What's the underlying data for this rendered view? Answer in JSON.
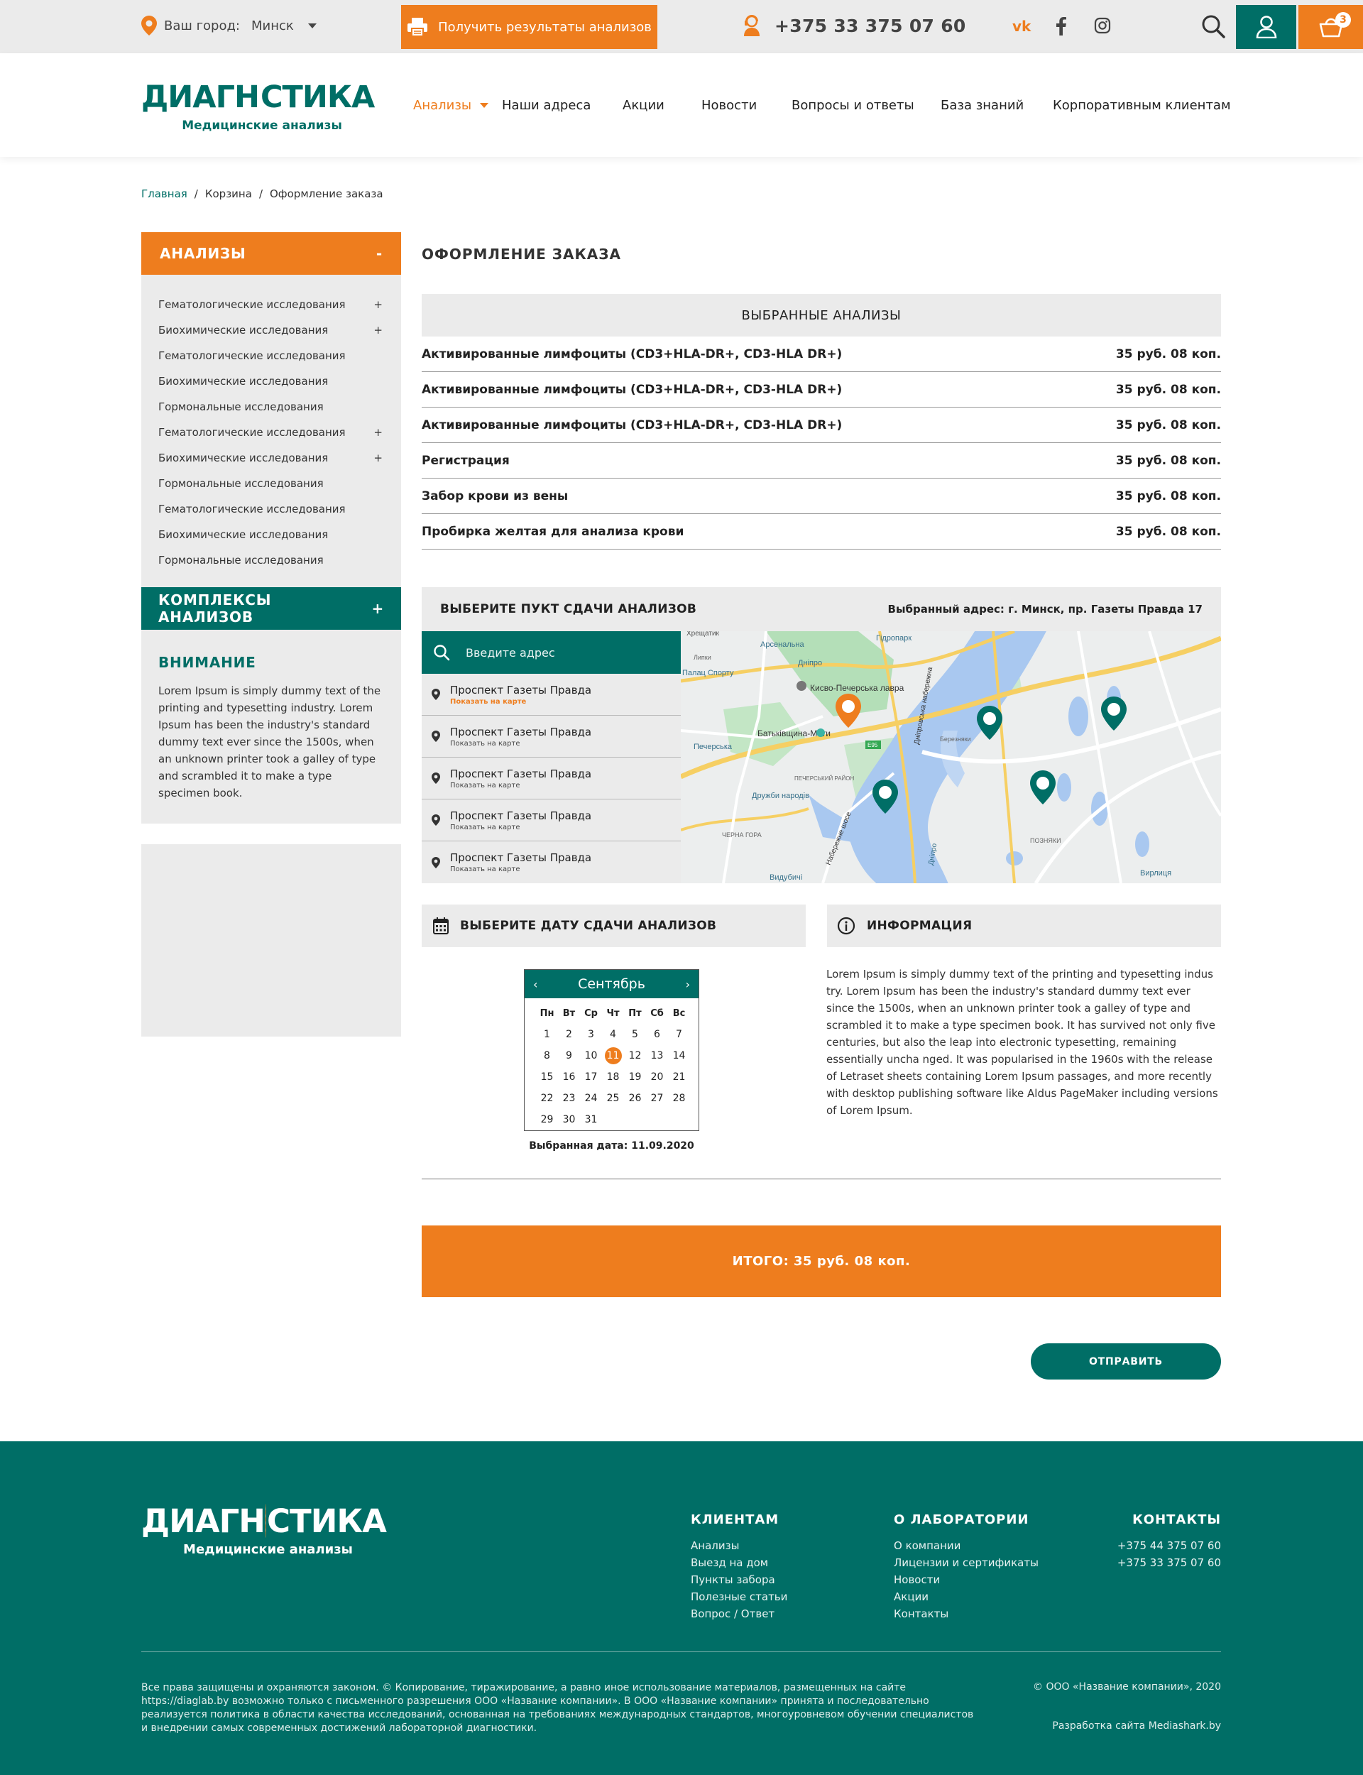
{
  "colors": {
    "accent": "#ee7d1e",
    "brand": "#006e66",
    "panel": "#ebebeb"
  },
  "topbar": {
    "city_label": "Ваш город:",
    "city_value": "Минск",
    "results_button": "Получить результаты анализов",
    "phone": "+375 33 375 07 60",
    "socials": [
      "vk-icon",
      "facebook-icon",
      "instagram-icon"
    ],
    "cart_count": "3"
  },
  "header": {
    "logo_title_left": "ДИАГН",
    "logo_title_right": "СТИКА",
    "logo_subtitle": "Медицинские анализы",
    "nav": [
      "Анализы",
      "Наши адреса",
      "Акции",
      "Новости",
      "Вопросы и ответы",
      "База знаний",
      "Корпоративным клиентам"
    ]
  },
  "breadcrumbs": [
    "Главная",
    "/",
    "Корзина",
    "/",
    "Оформление заказа"
  ],
  "sidebar": {
    "analyses_title": "АНАЛИЗЫ",
    "analyses_toggle": "-",
    "items": [
      {
        "label": "Гематологические исследования",
        "mark": "+"
      },
      {
        "label": "Биохимические исследования",
        "mark": "+"
      },
      {
        "label": "Гематологические исследования",
        "mark": ""
      },
      {
        "label": "Биохимические исследования",
        "mark": ""
      },
      {
        "label": "Гормональные исследования",
        "mark": ""
      },
      {
        "label": "Гематологические исследования",
        "mark": "+"
      },
      {
        "label": "Биохимические исследования",
        "mark": "+"
      },
      {
        "label": "Гормональные исследования",
        "mark": ""
      },
      {
        "label": "Гематологические исследования",
        "mark": ""
      },
      {
        "label": "Биохимические исследования",
        "mark": ""
      },
      {
        "label": "Гормональные исследования",
        "mark": ""
      }
    ],
    "complex_title": "КОМПЛЕКСЫ АНАЛИЗОВ",
    "complex_toggle": "+",
    "attention_title": "ВНИМАНИЕ",
    "attention_text": "Lorem Ipsum is simply dummy text of the printing and typesetting industry. Lorem Ipsum has been the industry's standard dummy text ever since the 1500s, when an unknown printer took a galley of type and scrambled it to make a type specimen book."
  },
  "main": {
    "title": "ОФОРМЛЕНИЕ ЗАКАЗА",
    "selected_title": "ВЫБРАННЫЕ АНАЛИЗЫ",
    "services": [
      {
        "name": "Активированные лимфоциты (CD3+HLA-DR+, CD3-HLA DR+)",
        "price": "35 руб. 08 коп."
      },
      {
        "name": "Активированные лимфоциты (CD3+HLA-DR+, CD3-HLA DR+)",
        "price": "35 руб. 08 коп."
      },
      {
        "name": "Активированные лимфоциты (CD3+HLA-DR+, CD3-HLA DR+)",
        "price": "35 руб. 08 коп."
      },
      {
        "name": "Регистрация",
        "price": "35 руб. 08 коп."
      },
      {
        "name": "Забор крови из вены",
        "price": "35 руб. 08 коп."
      },
      {
        "name": "Пробирка желтая для анализа крови",
        "price": "35 руб. 08 коп."
      }
    ],
    "pickup_title": "ВЫБЕРИТЕ ПУКТ СДАЧИ АНАЛИЗОВ",
    "pickup_selected": "Выбранный адрес: г. Минск, пр. Газеты Правда 17",
    "search_placeholder": "Введите адрес",
    "addresses": [
      {
        "name": "Проспект Газеты Правда",
        "link": "Показать на карте"
      },
      {
        "name": "Проспект Газеты Правда",
        "link": "Показать на карте"
      },
      {
        "name": "Проспект Газеты Правда",
        "link": "Показать на карте"
      },
      {
        "name": "Проспект Газеты Правда",
        "link": "Показать на карте"
      },
      {
        "name": "Проспект Газеты Правда",
        "link": "Показать на карте"
      }
    ],
    "map_labels": [
      "Хрещатик",
      "Арсенальна",
      "Гідропарк",
      "Дніпро",
      "Липки",
      "Палац Спорту",
      "Кисво-Печерська лавра",
      "Печерська",
      "Батьківщина-Мати",
      "ПЕЧЕРСЬКИЙ РАЙОН",
      "Дружби народів",
      "ЧЕРНА ГОРА",
      "Видубичі",
      "Березняки",
      "ПОЗНЯКИ",
      "Вирлиця",
      "Дніпро",
      "E95",
      "Дніпровська набережна",
      "Набережне шосе"
    ],
    "date_title": "ВЫБЕРИТЕ ДАТУ СДАЧИ АНАЛИЗОВ",
    "info_title": "ИНФОРМАЦИЯ",
    "calendar": {
      "month": "Сентябрь",
      "prev": "‹",
      "next": "›",
      "weekdays": [
        "Пн",
        "Вт",
        "Ср",
        "Чт",
        "Пт",
        "Сб",
        "Вс"
      ],
      "days": [
        "1",
        "2",
        "3",
        "4",
        "5",
        "6",
        "7",
        "8",
        "9",
        "10",
        "11",
        "12",
        "13",
        "14",
        "15",
        "16",
        "17",
        "18",
        "19",
        "20",
        "21",
        "22",
        "23",
        "24",
        "25",
        "26",
        "27",
        "28",
        "29",
        "30",
        "31"
      ],
      "selected_day": "11"
    },
    "selected_date": "Выбранная дата: 11.09.2020",
    "info_text": "Lorem Ipsum is simply dummy text of the printing and typesetting indus try. Lorem Ipsum has been the industry's standard dummy text ever since the 1500s, when an unknown printer took a galley of type and scrambled it to make a type specimen book. It has survived not only five centuries, but also the leap into electronic typesetting, remaining essentially uncha nged. It was popularised in the 1960s with the release of Letraset sheets containing Lorem Ipsum passages, and more recently with desktop publishing software like Aldus PageMaker including versions of Lorem Ipsum.",
    "total": "ИТОГО: 35 руб. 08 коп.",
    "submit": "ОТПРАВИТЬ"
  },
  "footer": {
    "logo_title_left": "ДИАГН",
    "logo_title_right": "СТИКА",
    "logo_subtitle": "Медицинские анализы",
    "clients_title": "КЛИЕНТАМ",
    "clients_links": [
      "Анализы",
      "Выезд на дом",
      "Пункты забора",
      "Полезные статьи",
      "Вопрос / Ответ"
    ],
    "lab_title": "О ЛАБОРАТОРИИ",
    "lab_links": [
      "О компании",
      "Лицензии и сертификаты",
      "Новости",
      "Акции",
      "Контакты"
    ],
    "contacts_title": "КОНТАКТЫ",
    "phones": [
      "+375 44 375 07 60",
      "+375 33 375 07 60"
    ],
    "legal": "Все права защищены и охраняются законом. © Копирование, тиражирование, а равно иное использование материалов, размещенных на сайте https://diaglab.by возможно только с письменного разрешения ООО «Название компании». В ООО «Название компании» принята и последовательно реализуется политика в области качества исследований, основанная на требованиях международных стандартов, многоуровневом обучении специалистов и внедрении самых современных достижений лабораторной диагностики.",
    "copyright": "© ООО «Название компании», 2020",
    "developer": "Разработка сайта Mediashark.by"
  }
}
